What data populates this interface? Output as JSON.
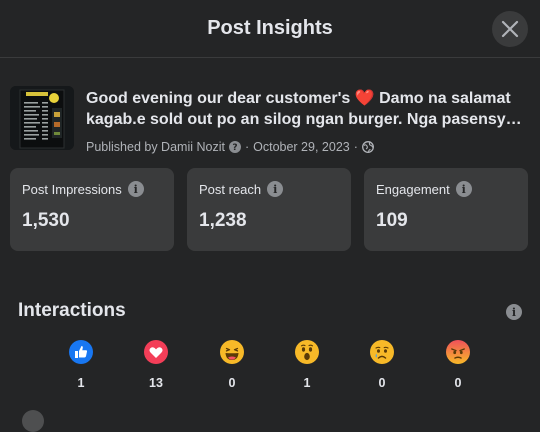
{
  "dialog": {
    "title": "Post Insights"
  },
  "post": {
    "text": "Good evening our dear customer's ❤️ Damo na salamat kagab.e sold out po an silog ngan burger. Nga pasensya po",
    "published_by": "Published by Damii Nozit",
    "date": "October 29, 2023",
    "separator": "·"
  },
  "stats": [
    {
      "label": "Post Impressions",
      "value": "1,530"
    },
    {
      "label": "Post reach",
      "value": "1,238"
    },
    {
      "label": "Engagement",
      "value": "109"
    }
  ],
  "interactions": {
    "title": "Interactions",
    "reactions": [
      {
        "name": "like",
        "count": "1"
      },
      {
        "name": "love",
        "count": "13"
      },
      {
        "name": "haha",
        "count": "0"
      },
      {
        "name": "wow",
        "count": "1"
      },
      {
        "name": "sad",
        "count": "0"
      },
      {
        "name": "angry",
        "count": "0"
      }
    ]
  },
  "colors": {
    "background": "#242526",
    "card": "#3a3b3c",
    "like": "#1877f2",
    "love": "#f33e58",
    "emoji_yellow": "#f7b928",
    "angry": "#e9710f"
  }
}
